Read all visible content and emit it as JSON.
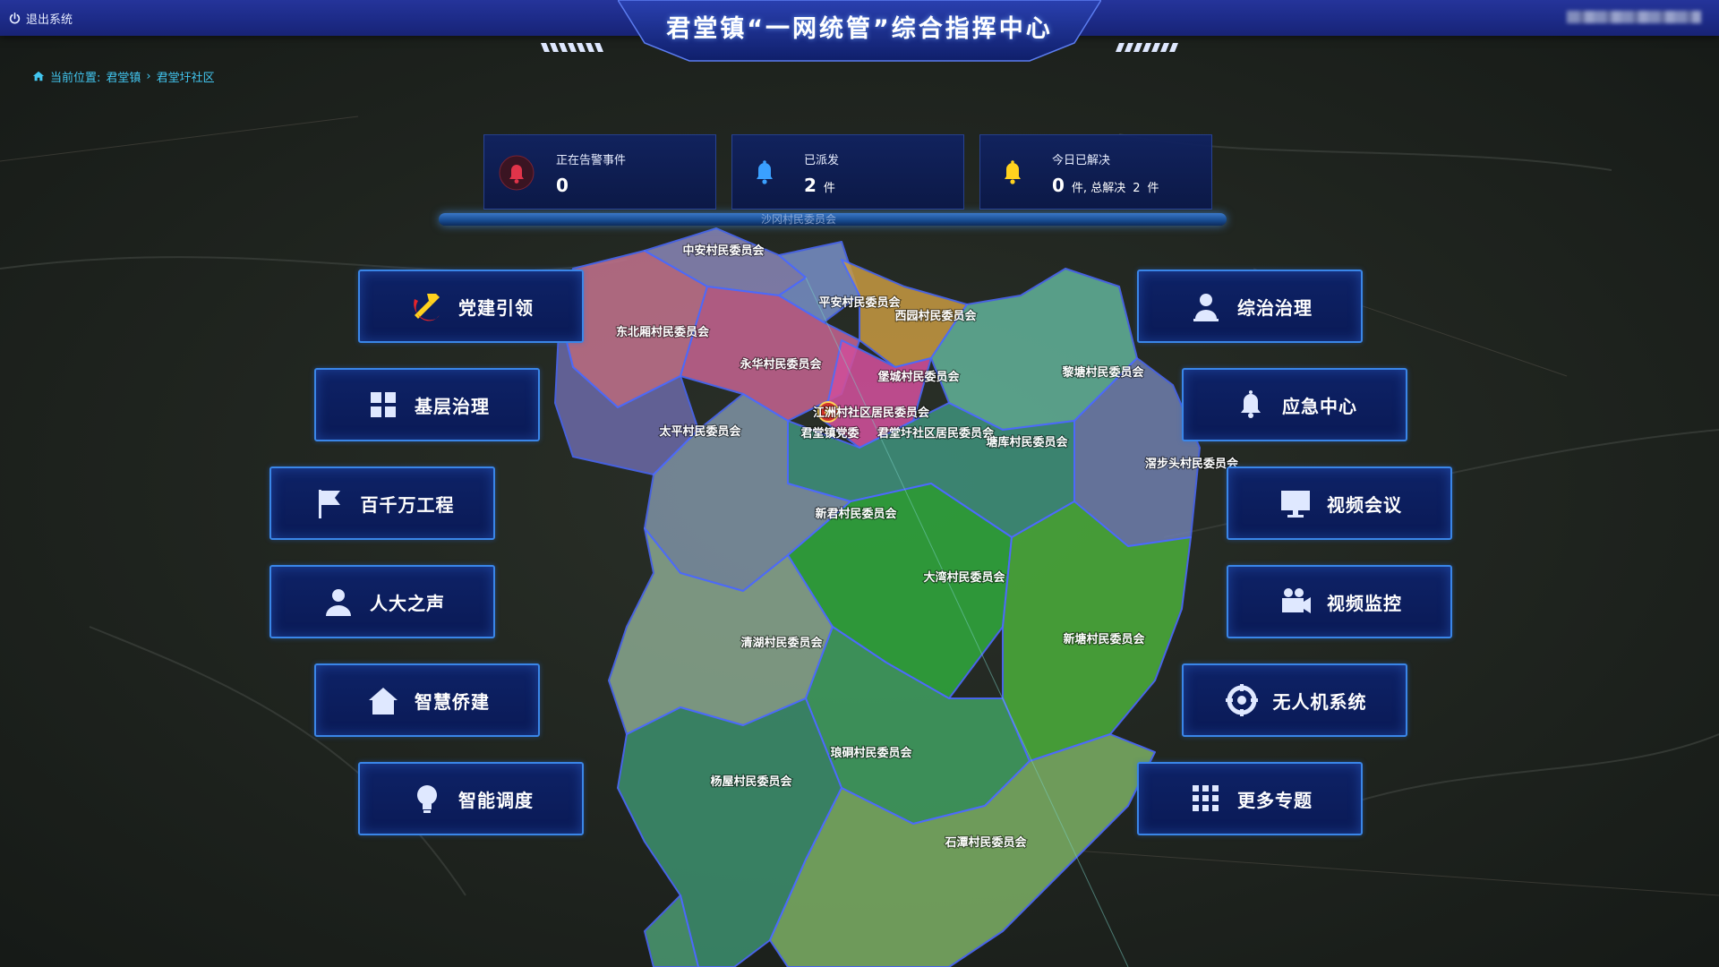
{
  "header": {
    "logout_label": "退出系统",
    "title": "君堂镇“一网统管”综合指挥中心"
  },
  "breadcrumb": {
    "prefix": "当前位置:",
    "items": [
      "君堂镇",
      "君堂圩社区"
    ]
  },
  "stats": [
    {
      "label": "正在告警事件",
      "value": "0",
      "unit": "",
      "icon": "alarm-bell-icon",
      "color": "#e0344a"
    },
    {
      "label": "已派发",
      "value": "2",
      "unit": "件",
      "icon": "bell-icon",
      "color": "#3aa0ff"
    },
    {
      "label": "今日已解决",
      "value": "0",
      "unit": "件,",
      "extra_prefix": "总解决",
      "extra_value": "2",
      "extra_unit": "件",
      "icon": "bell-icon",
      "color": "#ffd21e"
    }
  ],
  "stats_base_label": "沙冈村民委员会",
  "menu_left": [
    {
      "label": "党建引领",
      "icon": "hammer-sickle-icon"
    },
    {
      "label": "基层治理",
      "icon": "grid-icon"
    },
    {
      "label": "百千万工程",
      "icon": "flag-icon"
    },
    {
      "label": "人大之声",
      "icon": "person-icon"
    },
    {
      "label": "智慧侨建",
      "icon": "house-icon"
    },
    {
      "label": "智能调度",
      "icon": "lightbulb-icon"
    }
  ],
  "menu_right": [
    {
      "label": "综治治理",
      "icon": "officer-icon"
    },
    {
      "label": "应急中心",
      "icon": "bell-icon"
    },
    {
      "label": "视频会议",
      "icon": "monitor-icon"
    },
    {
      "label": "视频监控",
      "icon": "camera-icon"
    },
    {
      "label": "无人机系统",
      "icon": "drone-icon"
    },
    {
      "label": "更多专题",
      "icon": "dots-grid-icon"
    }
  ],
  "map_labels": [
    "中安村民委员会",
    "平安村民委员会",
    "西园村民委员会",
    "东北厢村民委员会",
    "永华村民委员会",
    "堡城村民委员会",
    "黎塘村民委员会",
    "江洲村社区居民委员会",
    "太平村民委员会",
    "君堂镇党委",
    "君堂圩社区居民委员会",
    "塘库村民委员会",
    "滘步头村民委员会",
    "新君村民委员会",
    "大湾村民委员会",
    "清湖村民委员会",
    "新塘村民委员会",
    "琅硐村民委员会",
    "杨屋村民委员会",
    "石潭村民委员会"
  ]
}
